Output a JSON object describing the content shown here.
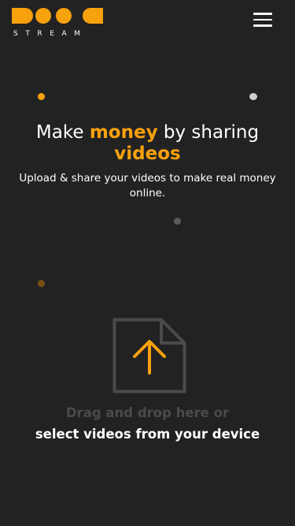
{
  "brand": {
    "name": "STREAM",
    "accent_color": "#f7a10d"
  },
  "header": {
    "menu_icon": "hamburger-menu-icon"
  },
  "hero": {
    "title_part1": "Make ",
    "title_highlight1": "money",
    "title_part2": " by sharing",
    "title_highlight2": "videos",
    "subtitle": "Upload & share your videos to make real money online."
  },
  "upload": {
    "icon": "file-upload-arrow-icon",
    "drop_text": "Drag and drop here or",
    "select_text": "select videos from your device"
  }
}
